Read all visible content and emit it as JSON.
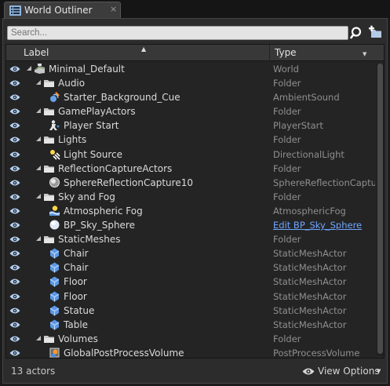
{
  "tab": {
    "title": "World Outliner",
    "close": "×"
  },
  "search": {
    "placeholder": "Search..."
  },
  "header": {
    "label": "Label",
    "type": "Type"
  },
  "rows": [
    {
      "name": "Minimal_Default",
      "type": "World",
      "depth": 0,
      "icon": "world-icon",
      "expanded": true
    },
    {
      "name": "Audio",
      "type": "Folder",
      "depth": 1,
      "icon": "folder-icon",
      "expanded": true
    },
    {
      "name": "Starter_Background_Cue",
      "type": "AmbientSound",
      "depth": 2,
      "icon": "ambient-sound-icon"
    },
    {
      "name": "GamePlayActors",
      "type": "Folder",
      "depth": 1,
      "icon": "folder-icon",
      "expanded": true
    },
    {
      "name": "Player Start",
      "type": "PlayerStart",
      "depth": 2,
      "icon": "player-start-icon"
    },
    {
      "name": "Lights",
      "type": "Folder",
      "depth": 1,
      "icon": "folder-icon",
      "expanded": true
    },
    {
      "name": "Light Source",
      "type": "DirectionalLight",
      "depth": 2,
      "icon": "directional-light-icon"
    },
    {
      "name": "ReflectionCaptureActors",
      "type": "Folder",
      "depth": 1,
      "icon": "folder-icon",
      "expanded": true
    },
    {
      "name": "SphereReflectionCapture10",
      "type": "SphereReflectionCapture",
      "depth": 2,
      "icon": "reflection-capture-icon"
    },
    {
      "name": "Sky and Fog",
      "type": "Folder",
      "depth": 1,
      "icon": "folder-icon",
      "expanded": true
    },
    {
      "name": "Atmospheric Fog",
      "type": "AtmosphericFog",
      "depth": 2,
      "icon": "atmospheric-fog-icon"
    },
    {
      "name": "BP_Sky_Sphere",
      "type": "Edit BP_Sky_Sphere",
      "depth": 2,
      "icon": "sky-sphere-icon",
      "link": true
    },
    {
      "name": "StaticMeshes",
      "type": "Folder",
      "depth": 1,
      "icon": "folder-icon",
      "expanded": true
    },
    {
      "name": "Chair",
      "type": "StaticMeshActor",
      "depth": 2,
      "icon": "static-mesh-icon"
    },
    {
      "name": "Chair",
      "type": "StaticMeshActor",
      "depth": 2,
      "icon": "static-mesh-icon"
    },
    {
      "name": "Floor",
      "type": "StaticMeshActor",
      "depth": 2,
      "icon": "static-mesh-icon"
    },
    {
      "name": "Floor",
      "type": "StaticMeshActor",
      "depth": 2,
      "icon": "static-mesh-icon"
    },
    {
      "name": "Statue",
      "type": "StaticMeshActor",
      "depth": 2,
      "icon": "static-mesh-icon"
    },
    {
      "name": "Table",
      "type": "StaticMeshActor",
      "depth": 2,
      "icon": "static-mesh-icon"
    },
    {
      "name": "Volumes",
      "type": "Folder",
      "depth": 1,
      "icon": "folder-icon",
      "expanded": true
    },
    {
      "name": "GlobalPostProcessVolume",
      "type": "PostProcessVolume",
      "depth": 2,
      "icon": "post-process-volume-icon"
    }
  ],
  "footer": {
    "actor_count": "13 actors",
    "view_options": "View Options"
  },
  "colors": {
    "accent_link": "#6fa6ff",
    "eye": "#b9d2ee",
    "folder": "#c9c9c9"
  }
}
